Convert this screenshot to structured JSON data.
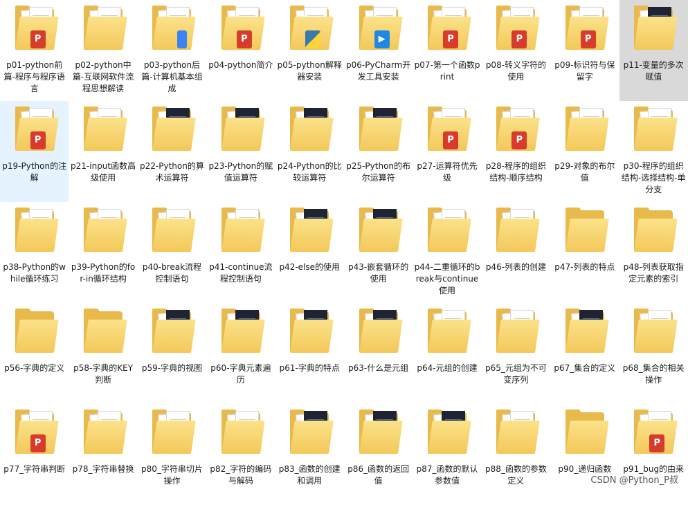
{
  "folders": [
    {
      "label": "p01-python前篇-程序与程序语言",
      "badge": "ppt"
    },
    {
      "label": "p02-python中篇-互联网软件流程思想解读",
      "badge": "none"
    },
    {
      "label": "p03-python后篇-计算机基本组成",
      "badge": "blue"
    },
    {
      "label": "p04-python简介",
      "badge": "ppt"
    },
    {
      "label": "p05-python解释器安装",
      "badge": "py"
    },
    {
      "label": "p06-PyCharm开发工具安装",
      "badge": "pyc"
    },
    {
      "label": "p07-第一个函数print",
      "badge": "ppt"
    },
    {
      "label": "p08-转义字符的使用",
      "badge": "ppt"
    },
    {
      "label": "p09-标识符与保留字",
      "badge": "ppt"
    },
    {
      "label": "p11-变量的多次赋值",
      "badge": "dark",
      "state": "selected"
    },
    {
      "label": "p19-Python的注解",
      "badge": "ppt",
      "state": "hover"
    },
    {
      "label": "p21-input函数高级使用",
      "badge": "none"
    },
    {
      "label": "p22-Python的算术运算符",
      "badge": "dark"
    },
    {
      "label": "p23-Python的赋值运算符",
      "badge": "dark"
    },
    {
      "label": "p24-Python的比较运算符",
      "badge": "dark"
    },
    {
      "label": "p25-Python的布尔运算符",
      "badge": "dark"
    },
    {
      "label": "p27-运算符优先级",
      "badge": "ppt"
    },
    {
      "label": "p28-程序的组织结构-顺序结构",
      "badge": "ppt"
    },
    {
      "label": "p29-对象的布尔值",
      "badge": "none"
    },
    {
      "label": "p30-程序的组织结构-选择结构-单分支",
      "badge": "none"
    },
    {
      "label": "p38-Python的while循环练习",
      "badge": "none"
    },
    {
      "label": "p39-Python的for-in循环结构",
      "badge": "none"
    },
    {
      "label": "p40-break流程控制语句",
      "badge": "none"
    },
    {
      "label": "p41-continue流程控制语句",
      "badge": "none"
    },
    {
      "label": "p42-else的使用",
      "badge": "dark"
    },
    {
      "label": "p43-嵌套循环的使用",
      "badge": "dark"
    },
    {
      "label": "p44-二重循环的break与continue使用",
      "badge": "none"
    },
    {
      "label": "p46-列表的创建",
      "badge": "none"
    },
    {
      "label": "p47-列表的特点",
      "badge": "empty"
    },
    {
      "label": "p48-列表获取指定元素的索引",
      "badge": "empty"
    },
    {
      "label": "p56-字典的定义",
      "badge": "empty"
    },
    {
      "label": "p58-字典的KEY判断",
      "badge": "empty"
    },
    {
      "label": "p59-字典的视图",
      "badge": "dark"
    },
    {
      "label": "p60-字典元素遍历",
      "badge": "dark"
    },
    {
      "label": "p61-字典的特点",
      "badge": "dark"
    },
    {
      "label": "p63-什么是元组",
      "badge": "dark"
    },
    {
      "label": "p64-元组的创建",
      "badge": "none"
    },
    {
      "label": "p65_元组为不可变序列",
      "badge": "none"
    },
    {
      "label": "p67_集合的定义",
      "badge": "dark"
    },
    {
      "label": "p68_集合的相关操作",
      "badge": "none"
    },
    {
      "label": "p77_字符串判断",
      "badge": "ppt"
    },
    {
      "label": "p78_字符串替换",
      "badge": "none"
    },
    {
      "label": "p80_字符串切片操作",
      "badge": "none"
    },
    {
      "label": "p82_字符的编码与解码",
      "badge": "none"
    },
    {
      "label": "p83_函数的创建和调用",
      "badge": "dark"
    },
    {
      "label": "p86_函数的返回值",
      "badge": "dark"
    },
    {
      "label": "p87_函数的默认参数值",
      "badge": "dark"
    },
    {
      "label": "p88_函数的参数定义",
      "badge": "none"
    },
    {
      "label": "p90_递归函数",
      "badge": "empty"
    },
    {
      "label": "p91_bug的由来",
      "badge": "ppt"
    }
  ],
  "watermark": "CSDN @Python_P叔",
  "colors": {
    "folder": "#f3c85a",
    "selected": "#d9d9d9",
    "hover": "#e5f3ff",
    "ppt": "#d83b2b"
  }
}
